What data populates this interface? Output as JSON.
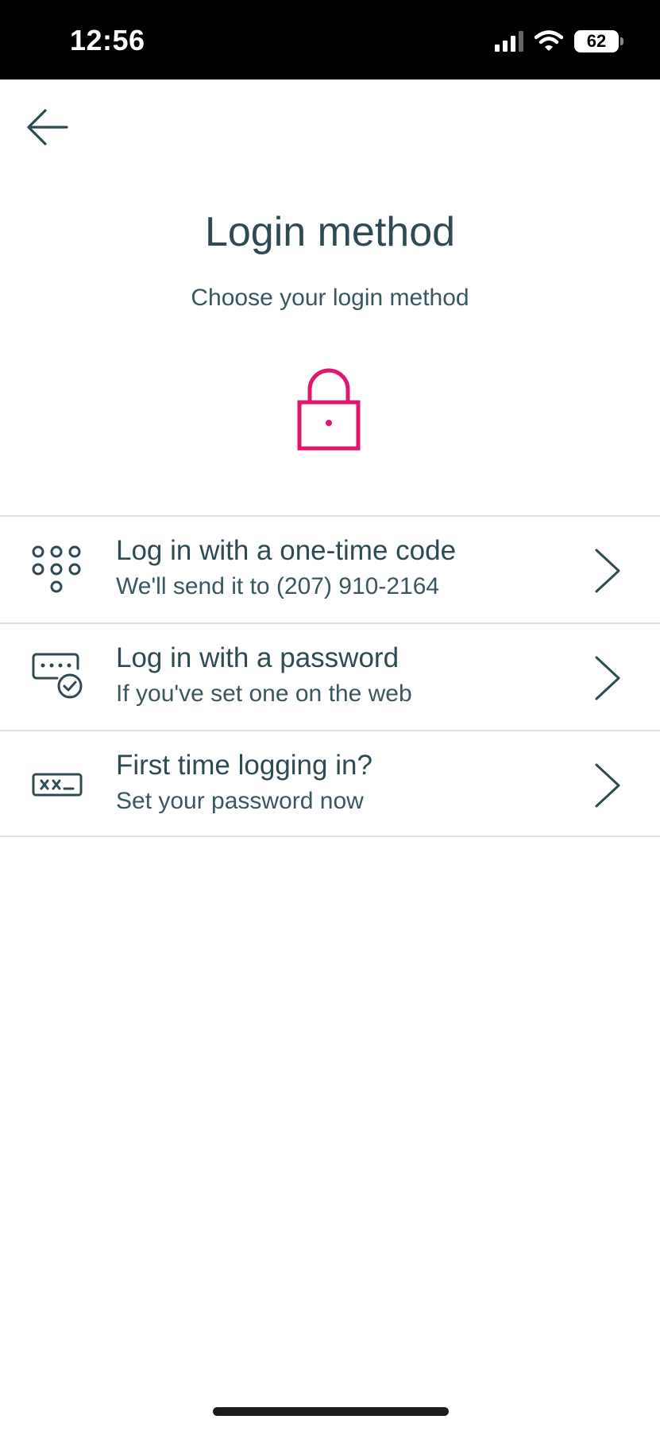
{
  "status_bar": {
    "time": "12:56",
    "battery": "62"
  },
  "header": {
    "title": "Login method",
    "subtitle": "Choose your login method",
    "icon": "lock-icon",
    "accent_color": "#e0166f"
  },
  "methods": [
    {
      "title": "Log in with a one-time code",
      "description": "We'll send it to (207) 910-2164",
      "icon": "keypad-icon"
    },
    {
      "title": "Log in with a password",
      "description": "If you've set one on the web",
      "icon": "password-check-icon"
    },
    {
      "title": "First time logging in?",
      "description": "Set your password now",
      "icon": "password-field-icon"
    }
  ],
  "colors": {
    "text": "#2f4a52",
    "divider": "#dfe3e4",
    "status_bar_bg": "#000000"
  }
}
